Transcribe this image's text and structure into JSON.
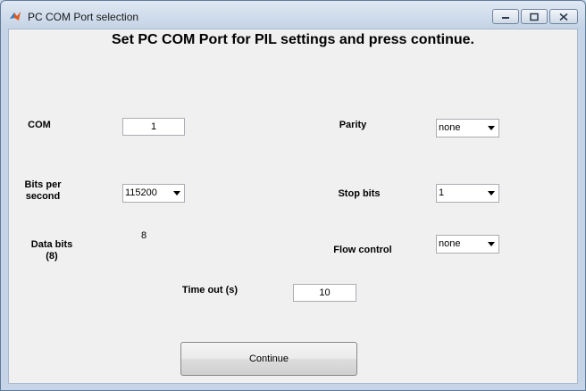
{
  "window": {
    "title": "PC COM Port selection"
  },
  "heading": "Set PC COM Port for PIL settings and press continue.",
  "left": {
    "com_label": "COM",
    "com_value": "1",
    "bits_label_line1": "Bits per",
    "bits_label_line2": "second",
    "bits_value": "115200",
    "data_bits_label_line1": "Data bits",
    "data_bits_label_line2": "(8)",
    "data_bits_value": "8"
  },
  "right": {
    "parity_label": "Parity",
    "parity_value": "none",
    "stop_bits_label": "Stop bits",
    "stop_bits_value": "1",
    "flow_control_label": "Flow control",
    "flow_control_value": "none"
  },
  "timeout": {
    "label": "Time out (s)",
    "value": "10"
  },
  "continue_label": "Continue",
  "icons": {
    "app": "matlab-icon",
    "minimize": "minimize-icon",
    "maximize": "maximize-icon",
    "close": "close-icon",
    "dropdown": "chevron-down-icon"
  }
}
